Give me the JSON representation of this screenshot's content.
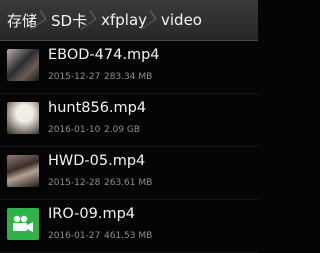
{
  "breadcrumb": [
    "存储",
    "SD卡",
    "xfplay",
    "video"
  ],
  "files": [
    {
      "name": "EBOD-474.mp4",
      "date": "2015-12-27",
      "size": "283.34 MB",
      "thumb": "video-thumbnail-1"
    },
    {
      "name": "hunt856.mp4",
      "date": "2016-01-10",
      "size": "2.09 GB",
      "thumb": "video-thumbnail-2"
    },
    {
      "name": "HWD-05.mp4",
      "date": "2015-12-28",
      "size": "263.61 MB",
      "thumb": "video-thumbnail-3"
    },
    {
      "name": "IRO-09.mp4",
      "date": "2016-01-27",
      "size": "461.53 MB",
      "thumb": "video-camera-icon"
    }
  ]
}
